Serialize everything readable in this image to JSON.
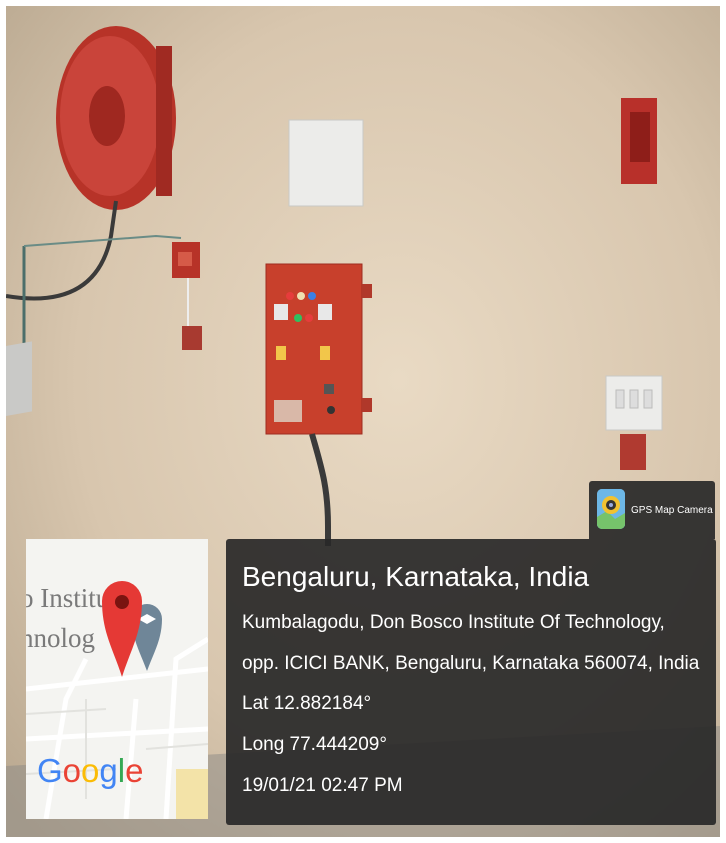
{
  "badge": {
    "label": "GPS Map Camera",
    "icon": "gps-map-camera-app-icon"
  },
  "location": {
    "title": "Bengaluru, Karnataka, India",
    "address_line1": "Kumbalagodu, Don Bosco Institute Of Technology,",
    "address_line2": "opp. ICICI BANK, Bengaluru, Karnataka 560074, India",
    "latitude": "Lat 12.882184°",
    "longitude": "Long 77.444209°",
    "timestamp": "19/01/21 02:47 PM"
  },
  "map": {
    "label_line1": "o Institu",
    "label_line2": "hnolog",
    "provider": "Google",
    "pin_icon": "map-pin-icon",
    "school_icon": "graduation-cap-pin-icon",
    "colors": {
      "pin": "#e53935",
      "school_pin": "#6f8698",
      "map_bg": "#f4f4f1"
    }
  },
  "scene_colors": {
    "wall": "#d6c6b0",
    "panel": "#c8402c",
    "hose_reel": "#c43b33"
  }
}
